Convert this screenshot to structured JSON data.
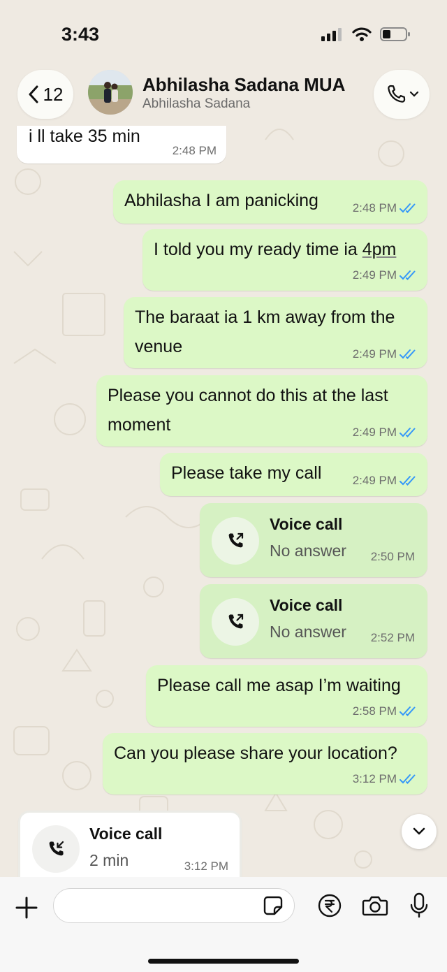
{
  "status_bar": {
    "time": "3:43"
  },
  "header": {
    "back_count": "12",
    "contact_name": "Abhilasha Sadana MUA",
    "contact_sub": "Abhilasha Sadana"
  },
  "messages": [
    {
      "type": "text",
      "direction": "in",
      "lines": [
        "i ll take 35 min"
      ],
      "time": "2:48 PM"
    },
    {
      "type": "text",
      "direction": "out",
      "lines": [
        "Abhilasha I am panicking"
      ],
      "time": "2:48 PM",
      "status": "read"
    },
    {
      "type": "text",
      "direction": "out",
      "lines": [
        "I told you my ready time ia ",
        "4pm"
      ],
      "time": "2:49 PM",
      "status": "read"
    },
    {
      "type": "text",
      "direction": "out",
      "lines": [
        "The baraat ia 1 km away from the",
        "venue"
      ],
      "time": "2:49 PM",
      "status": "read"
    },
    {
      "type": "text",
      "direction": "out",
      "lines": [
        "Please you cannot do this at the last",
        "moment"
      ],
      "time": "2:49 PM",
      "status": "read"
    },
    {
      "type": "text",
      "direction": "out",
      "lines": [
        "Please take my call"
      ],
      "time": "2:49 PM",
      "status": "read"
    },
    {
      "type": "call",
      "direction": "out",
      "title": "Voice call",
      "sub": "No answer",
      "time": "2:50 PM"
    },
    {
      "type": "call",
      "direction": "out",
      "title": "Voice call",
      "sub": "No answer",
      "time": "2:52 PM"
    },
    {
      "type": "text",
      "direction": "out",
      "lines": [
        "Please call me asap I’m waiting"
      ],
      "time": "2:58 PM",
      "status": "read"
    },
    {
      "type": "text",
      "direction": "out",
      "lines": [
        "Can you please share your location?"
      ],
      "time": "3:12 PM",
      "status": "read"
    },
    {
      "type": "call",
      "direction": "in",
      "title": "Voice call",
      "sub": "2 min",
      "time": "3:12 PM"
    }
  ],
  "composer": {
    "placeholder": ""
  },
  "colors": {
    "outgoing_bubble": "#dcf8c6",
    "incoming_bubble": "#ffffff",
    "read_ticks": "#3497f9",
    "chat_background": "#efeae2"
  },
  "icons": {
    "back": "chevron-left-icon",
    "call": "phone-icon",
    "missed_outgoing": "outgoing-call-icon",
    "incoming": "incoming-call-icon",
    "scroll": "chevron-down-icon",
    "plus": "plus-icon",
    "sticker": "sticker-icon",
    "payment": "rupee-icon",
    "camera": "camera-icon",
    "mic": "microphone-icon"
  }
}
